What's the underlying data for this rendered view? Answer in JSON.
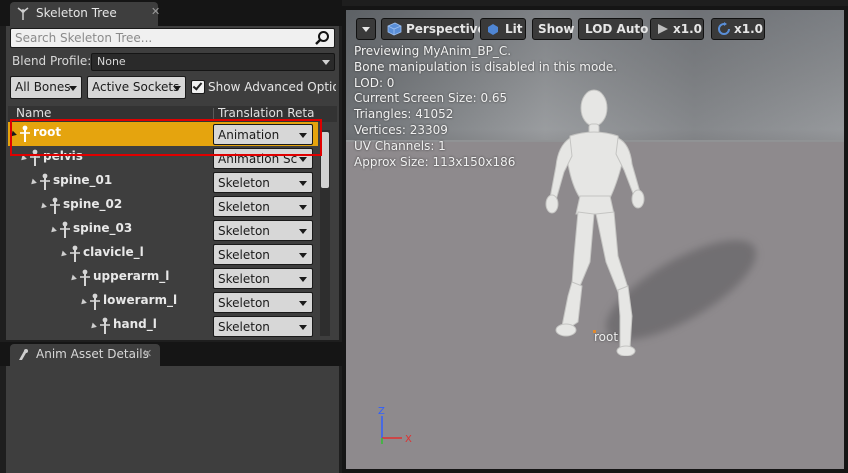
{
  "skeleton_tree": {
    "tab_title": "Skeleton Tree",
    "search_placeholder": "Search Skeleton Tree...",
    "blend_profile_label": "Blend Profile:",
    "blend_profile_value": "None",
    "all_bones_label": "All Bones",
    "active_sockets_label": "Active Sockets",
    "show_advanced_label": "Show Advanced Options",
    "show_advanced_checked": true,
    "col_name": "Name",
    "col_translation": "Translation Retargeting",
    "bones": [
      {
        "name": "root",
        "retarget": "Animation",
        "selected": true
      },
      {
        "name": "pelvis",
        "retarget": "Animation Scaled",
        "selected": false
      },
      {
        "name": "spine_01",
        "retarget": "Skeleton",
        "selected": false
      },
      {
        "name": "spine_02",
        "retarget": "Skeleton",
        "selected": false
      },
      {
        "name": "spine_03",
        "retarget": "Skeleton",
        "selected": false
      },
      {
        "name": "clavicle_l",
        "retarget": "Skeleton",
        "selected": false
      },
      {
        "name": "upperarm_l",
        "retarget": "Skeleton",
        "selected": false
      },
      {
        "name": "lowerarm_l",
        "retarget": "Skeleton",
        "selected": false
      },
      {
        "name": "hand_l",
        "retarget": "Skeleton",
        "selected": false
      }
    ]
  },
  "anim_details": {
    "tab_title": "Anim Asset Details"
  },
  "viewport": {
    "perspective_label": "Perspective",
    "lit_label": "Lit",
    "show_label": "Show",
    "lod_label": "LOD Auto",
    "play_speed": "x1.0",
    "rotate_speed": "x1.0",
    "info": {
      "previewing": "Previewing MyAnim_BP_C.",
      "bone_note": "Bone manipulation is disabled in this mode.",
      "lod": "LOD: 0",
      "screen_size": "Current Screen Size: 0.65",
      "triangles": "Triangles: 41052",
      "vertices": "Vertices: 23309",
      "uv_channels": "UV Channels: 1",
      "approx_size": "Approx Size: 113x150x186"
    },
    "root_label": "root",
    "axis_x": "X",
    "axis_z": "Z"
  },
  "colors": {
    "selection": "#e5a40e",
    "highlight_box": "#e00000",
    "panel": "#3e3e3e",
    "axis_x": "#e03030",
    "axis_y": "#30c030",
    "axis_z": "#3060ff"
  },
  "icons": {
    "skeleton_tab": "skeleton-icon",
    "search": "search-icon",
    "bone": "bone-icon",
    "details_tab": "details-icon",
    "perspective": "cube-icon",
    "lit": "sphere-icon",
    "play": "play-icon",
    "rotate": "rotate-icon"
  }
}
